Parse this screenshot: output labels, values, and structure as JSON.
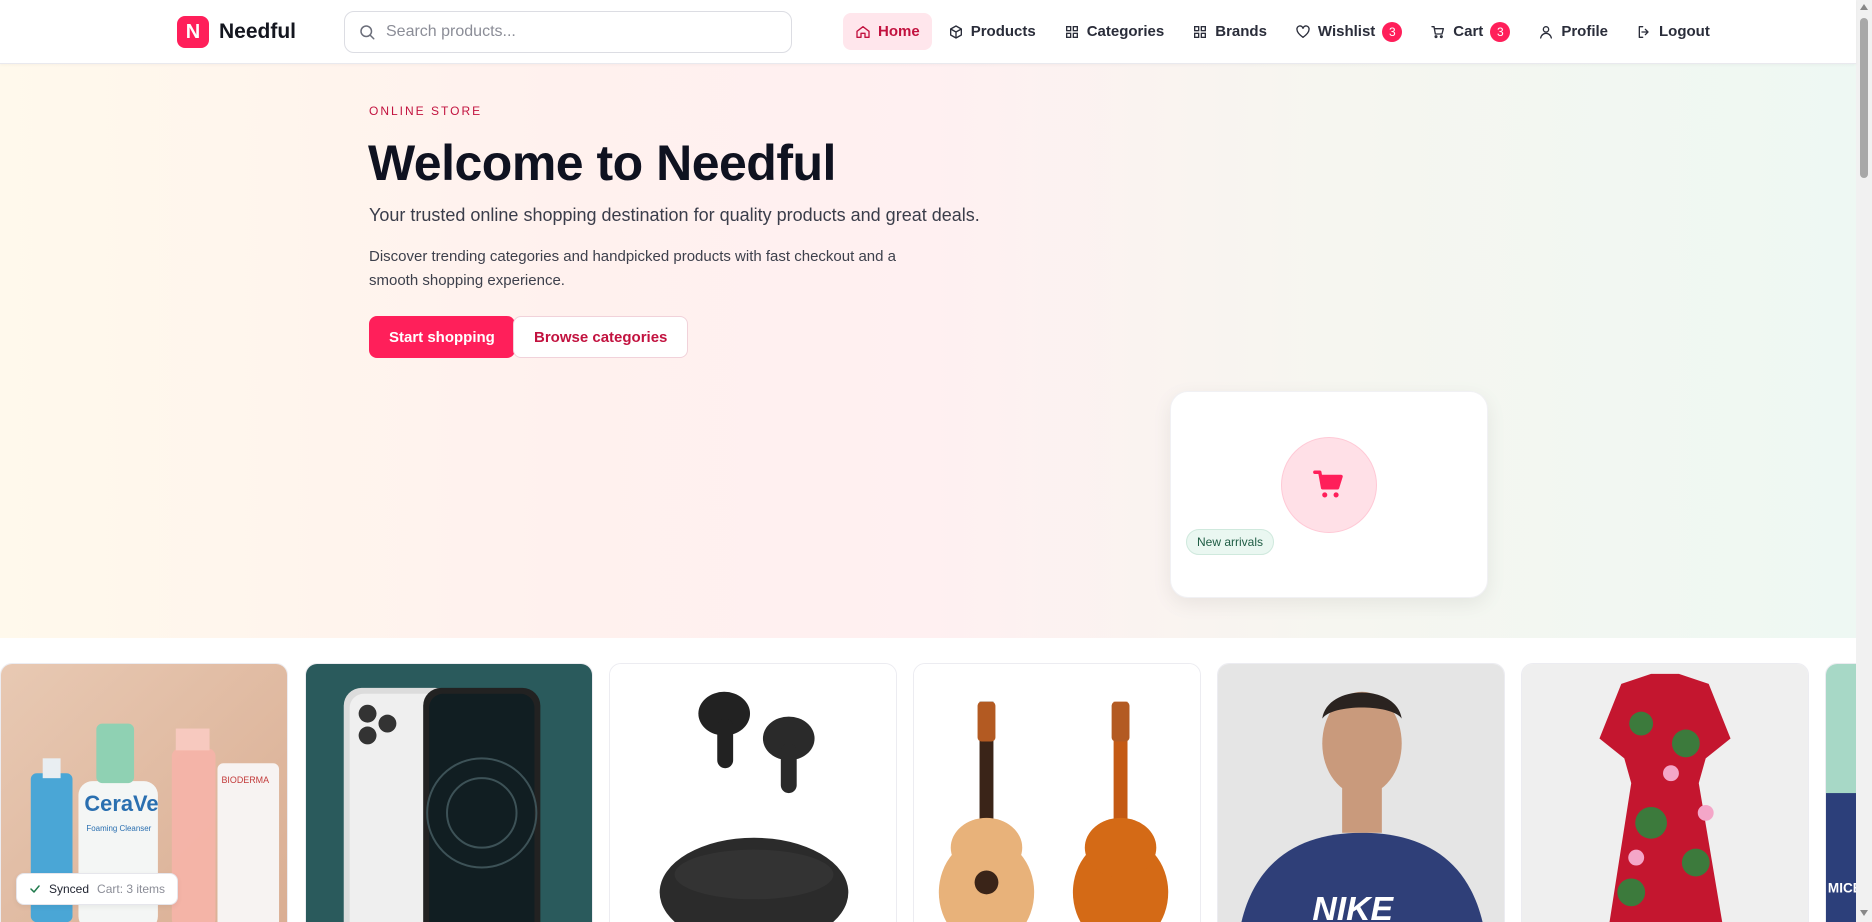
{
  "header": {
    "logo_letter": "N",
    "logo_text": "Needful",
    "search_placeholder": "Search products...",
    "nav": [
      {
        "label": "Home",
        "icon": "home-icon",
        "active": true
      },
      {
        "label": "Products",
        "icon": "box-icon"
      },
      {
        "label": "Categories",
        "icon": "grid-icon"
      },
      {
        "label": "Brands",
        "icon": "grid-icon"
      },
      {
        "label": "Wishlist",
        "icon": "heart-icon",
        "badge": "3"
      },
      {
        "label": "Cart",
        "icon": "cart-icon",
        "badge": "3"
      },
      {
        "label": "Profile",
        "icon": "user-icon"
      },
      {
        "label": "Logout",
        "icon": "logout-icon"
      }
    ]
  },
  "hero": {
    "eyebrow": "ONLINE STORE",
    "title": "Welcome to Needful",
    "subtitle": "Your trusted online shopping destination for quality products and great deals.",
    "description": "Discover trending categories and handpicked products with fast checkout and a smooth shopping experience.",
    "primary_button": "Start shopping",
    "secondary_button": "Browse categories",
    "promo_tag": "New arrivals",
    "promo_icon": "cart-icon"
  },
  "products_strip": [
    {
      "image": "skincare-bottles",
      "visible_text": [
        "CeraVe",
        "Foaming Cleanser",
        "BIODERMA"
      ]
    },
    {
      "image": "smartphone"
    },
    {
      "image": "wireless-earbuds"
    },
    {
      "image": "acoustic-guitars"
    },
    {
      "image": "man-in-hoodie",
      "visible_text": [
        "NIKE"
      ]
    },
    {
      "image": "floral-dress"
    },
    {
      "image": "partial-product",
      "visible_text": [
        "MICEL"
      ]
    }
  ],
  "status": {
    "label": "Synced",
    "detail": "Cart: 3 items"
  },
  "colors": {
    "brand": "#ff1f5a",
    "brand_dark": "#c2123f",
    "active_nav_bg": "#ffe6ec"
  }
}
